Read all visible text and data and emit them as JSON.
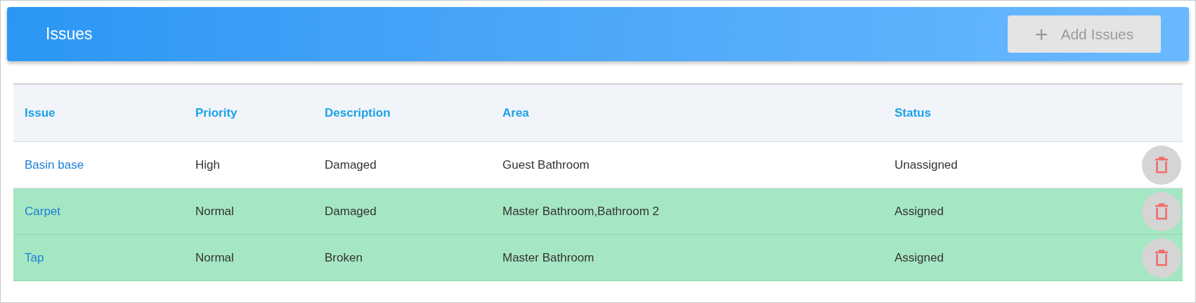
{
  "header": {
    "title": "Issues",
    "add_button": {
      "icon": "+",
      "label": "Add Issues",
      "disabled": true
    }
  },
  "table": {
    "columns": [
      "Issue",
      "Priority",
      "Description",
      "Area",
      "Status"
    ],
    "rows": [
      {
        "issue": "Basin base",
        "priority": "High",
        "description": "Damaged",
        "area": "Guest Bathroom",
        "status": "Unassigned",
        "highlighted": false
      },
      {
        "issue": "Carpet",
        "priority": "Normal",
        "description": "Damaged",
        "area": "Master Bathroom,Bathroom 2",
        "status": "Assigned",
        "highlighted": true
      },
      {
        "issue": "Tap",
        "priority": "Normal",
        "description": "Broken",
        "area": "Master Bathroom",
        "status": "Assigned",
        "highlighted": true
      }
    ]
  }
}
